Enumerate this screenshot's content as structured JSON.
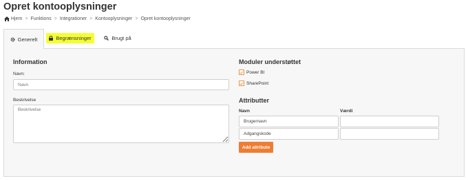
{
  "page": {
    "title": "Opret kontooplysninger"
  },
  "breadcrumb": [
    "Hjem",
    "Funktions",
    "Integrationer",
    "Kontooplysninger",
    "Opret kontooplysninger"
  ],
  "tabs": [
    {
      "label": "Generelt",
      "icon": "gear-icon",
      "active": true
    },
    {
      "label": "Begrænsninger",
      "icon": "lock-icon",
      "highlighted": true,
      "highlight_color": "#f4ff32"
    },
    {
      "label": "Brugt på",
      "icon": "search-icon"
    }
  ],
  "info": {
    "title": "Information",
    "name_label": "Navn:",
    "name_placeholder": "Navn",
    "description_label": "Beskrivelse",
    "description_placeholder": "Beskrivelse"
  },
  "modules": {
    "title": "Moduler understøttet",
    "items": [
      {
        "label": "Power BI",
        "checked": true
      },
      {
        "label": "SharePoint",
        "checked": true
      }
    ]
  },
  "attributes": {
    "title": "Attributter",
    "col_name": "Navn",
    "col_value": "Værdi",
    "rows": [
      {
        "name": "Brugernavn",
        "value": ""
      },
      {
        "name": "Adgangskode",
        "value": ""
      }
    ],
    "add_label": "Add attribute"
  },
  "colors": {
    "accent": "#ee7d33",
    "highlight": "#f4ff32",
    "panel_bg": "#f7f7f7"
  }
}
